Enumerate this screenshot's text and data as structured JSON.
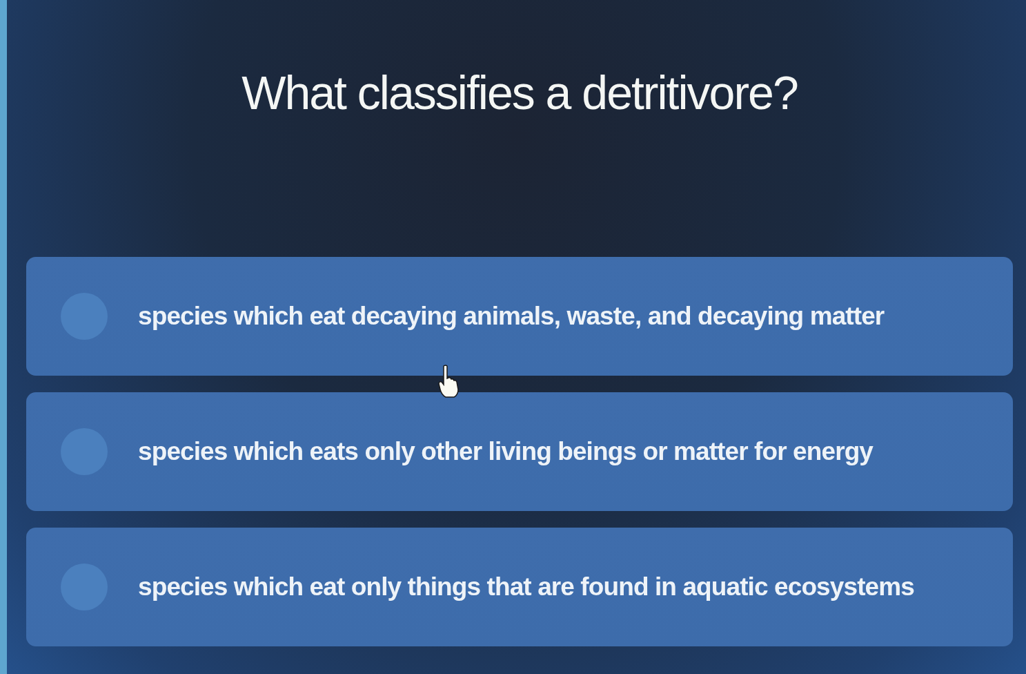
{
  "question": {
    "title": "What classifies a detritivore?"
  },
  "options": [
    {
      "label": "species which eat decaying animals, waste, and decaying matter",
      "selected": false
    },
    {
      "label": "species which eats only other living beings or matter for energy",
      "selected": false
    },
    {
      "label": "species which eat only things that are found in aquatic ecosystems",
      "selected": false
    }
  ]
}
